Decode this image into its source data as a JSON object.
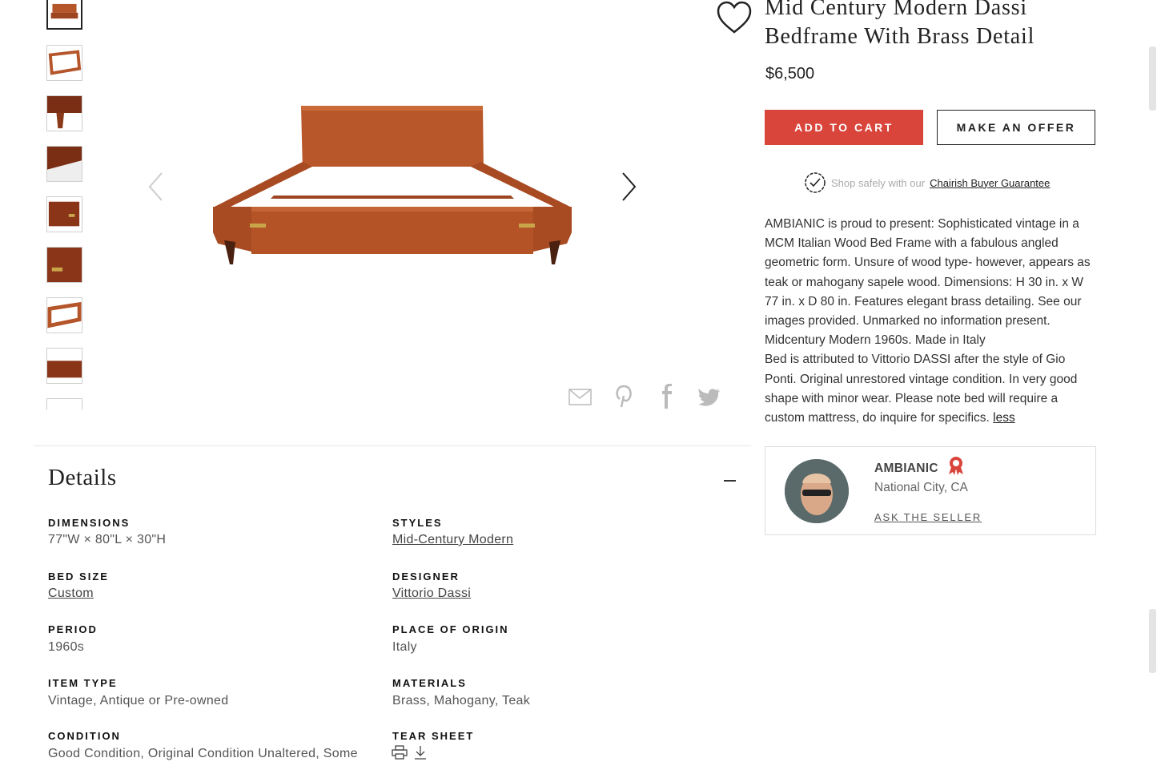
{
  "product": {
    "title": "Mid Century Modern Dassi Bedframe With Brass Detail",
    "price": "$6,500",
    "add_to_cart": "ADD TO CART",
    "make_offer": "MAKE AN OFFER",
    "guarantee_prefix": "Shop safely with our",
    "guarantee_link": "Chairish Buyer Guarantee",
    "description_p1": "AMBIANIC is proud to present: Sophisticated vintage in a MCM Italian Wood Bed Frame with a fabulous angled geometric form. Unsure of wood type- however, appears as teak or mahogany sapele wood. Dimensions: H 30 in. x W 77 in. x D 80 in. Features elegant brass detailing. See our images provided. Unmarked no information present. Midcentury Modern 1960s. Made in Italy",
    "description_p2": "Bed is attributed to Vittorio DASSI after the style of Gio Ponti. Original unrestored vintage condition. In very good shape with minor wear. Please note bed will require a custom mattress, do inquire for specifics.",
    "less_link": "less"
  },
  "seller": {
    "name": "AMBIANIC",
    "location": "National City, CA",
    "ask": "ASK THE SELLER"
  },
  "details": {
    "title": "Details",
    "dimensions_label": "DIMENSIONS",
    "dimensions_value": "77\"W × 80\"L × 30\"H",
    "styles_label": "STYLES",
    "styles_value": "Mid-Century Modern",
    "bed_size_label": "BED SIZE",
    "bed_size_value": "Custom",
    "designer_label": "DESIGNER",
    "designer_value": "Vittorio Dassi",
    "period_label": "PERIOD",
    "period_value": "1960s",
    "origin_label": "PLACE OF ORIGIN",
    "origin_value": "Italy",
    "item_type_label": "ITEM TYPE",
    "item_type_value": "Vintage, Antique or Pre-owned",
    "materials_label": "MATERIALS",
    "materials_value": "Brass, Mahogany, Teak",
    "condition_label": "CONDITION",
    "condition_value": "Good Condition, Original Condition Unaltered, Some",
    "tear_sheet_label": "TEAR SHEET"
  },
  "colors": {
    "accent": "#d9443b",
    "wood": "#b5552a"
  }
}
